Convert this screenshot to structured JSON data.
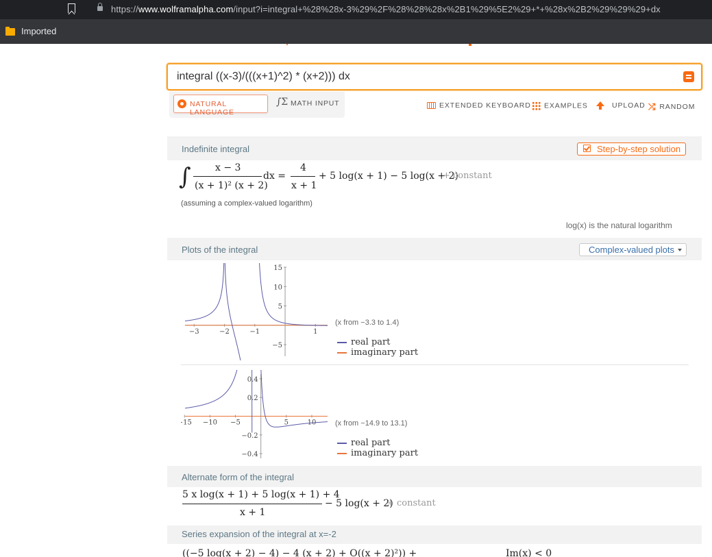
{
  "browser": {
    "url_prefix": "https://",
    "url_host": "www.wolframalpha.com",
    "url_rest": "/input?i=integral+%28%28x-3%29%2F%28%28%28x%2B1%29%5E2%29+*+%28x%2B2%29%29%29+dx",
    "bookmark_folder": "Imported"
  },
  "search": {
    "query": "integral ((x-3)/(((x+1)^2) * (x+2))) dx"
  },
  "input_modes": {
    "natural_language": "NATURAL LANGUAGE",
    "math_input": "MATH INPUT"
  },
  "toolbar": {
    "extended_keyboard": "EXTENDED KEYBOARD",
    "examples": "EXAMPLES",
    "upload": "UPLOAD",
    "random": "RANDOM"
  },
  "pods": {
    "indefinite": {
      "title": "Indefinite integral",
      "step_button": "Step-by-step solution",
      "integrand_num": "x − 3",
      "integrand_den": "(x + 1)² (x + 2)",
      "dx": "dx =",
      "result_num": "4",
      "result_den": "x + 1",
      "result_tail": "+ 5 log(x + 1) − 5 log(x + 2)",
      "constant": "+ constant",
      "assumption": "(assuming a complex-valued logarithm)",
      "note": "log(x) is the natural logarithm"
    },
    "plots": {
      "title": "Plots of the integral",
      "dropdown": "Complex-valued plots",
      "plot1_range": "(x from −3.3 to 1.4)",
      "plot2_range": "(x from −14.9 to 13.1)",
      "legend_real": "real part",
      "legend_imag": "imaginary part",
      "colors": {
        "real": "#5a5aa8",
        "imag": "#e8743b"
      }
    },
    "alternate": {
      "title": "Alternate form of the integral",
      "num": "5 x log(x + 1) + 5 log(x + 1) + 4",
      "den": "x + 1",
      "tail": "− 5 log(x + 2)",
      "constant": "+ constant"
    },
    "series": {
      "title": "Series expansion of the integral at x=-2",
      "partial": "((−5 log(x + 2) − 4) − 4 (x + 2) + O((x + 2)²)) +",
      "condition": "Im(x) < 0"
    }
  },
  "chart_data": [
    {
      "type": "line",
      "xlim": [
        -3.3,
        1.4
      ],
      "ylim": [
        -8,
        15
      ],
      "x_ticks": [
        "-3",
        "-2",
        "-1",
        "1"
      ],
      "y_ticks": [
        "15",
        "10",
        "5",
        "-5"
      ],
      "series": [
        {
          "name": "real part",
          "function": "4/(x+1) + 5 log|x+1| - 5 log|x+2|"
        },
        {
          "name": "imaginary part",
          "values": "0"
        }
      ]
    },
    {
      "type": "line",
      "xlim": [
        -14.9,
        13.1
      ],
      "ylim": [
        -0.45,
        0.45
      ],
      "x_ticks": [
        "-15",
        "-10",
        "-5",
        "5",
        "10"
      ],
      "y_ticks": [
        "0.4",
        "0.2",
        "-0.2",
        "-0.4"
      ],
      "series": [
        {
          "name": "real part",
          "function": "4/(x+1) + 5 log|x+1| - 5 log|x+2|"
        },
        {
          "name": "imaginary part",
          "values": "0"
        }
      ]
    }
  ]
}
